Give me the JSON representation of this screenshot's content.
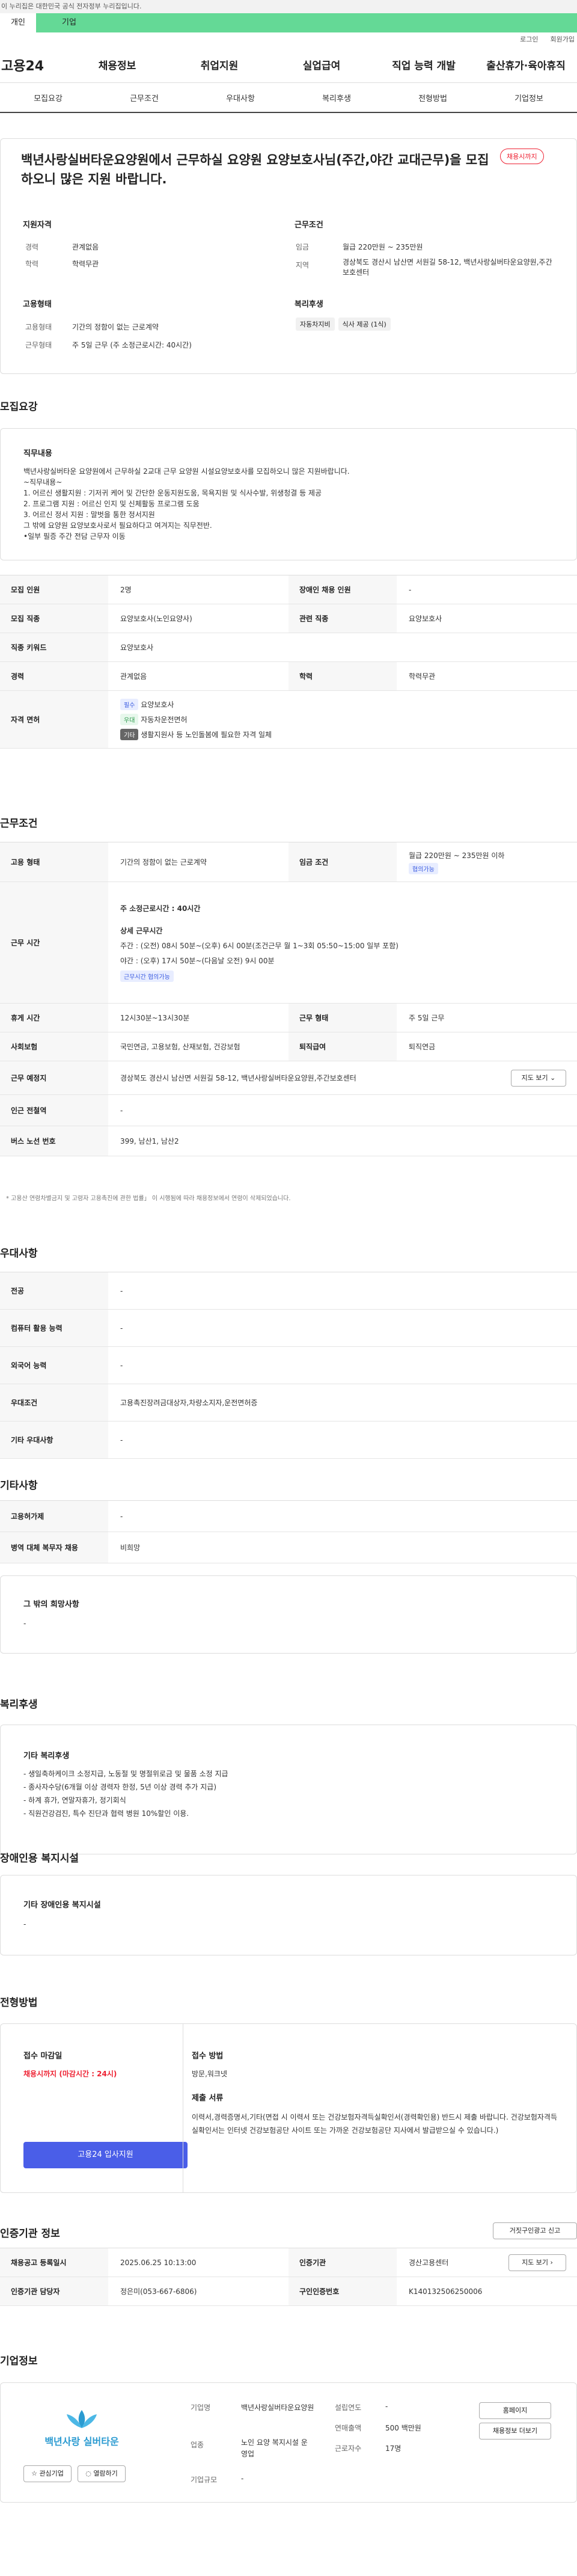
{
  "gov_banner": "이 누리집은 대한민국 공식 전자정부 누리집입니다.",
  "top_tabs": [
    "개인",
    "기업"
  ],
  "util": [
    "로그인",
    "회원가입"
  ],
  "logo": "고용24",
  "gnb": [
    "채용정보",
    "취업지원",
    "실업급여",
    "직업 능력 개발",
    "출산휴가·육아휴직"
  ],
  "subtabs": [
    "모집요강",
    "근무조건",
    "우대사항",
    "복리후생",
    "전형방법",
    "기업정보"
  ],
  "title": "백년사랑실버타운요양원에서 근무하실 요양원 요양보호사님(주간,야간 교대근무)을 모집하오니 많은 지원 바랍니다.",
  "status_badge": "채용시까지",
  "summary": {
    "qual_title": "지원자격",
    "career_k": "경력",
    "career_v": "관계없음",
    "edu_k": "학력",
    "edu_v": "학력무관",
    "cond_title": "근무조건",
    "wage_k": "임금",
    "wage_v": "월급 220만원 ~ 235만원",
    "area_k": "지역",
    "area_v": "경상북도 경산시 남산면 서원길 58-12, 백년사랑실버타운요양원,주간보호센터",
    "emp_title": "고용형태",
    "emp_k": "고용형태",
    "emp_v": "기간의 정함이 없는 근로계약",
    "work_k": "근무형태",
    "work_v": "주 5일 근무 (주 소정근로시간: 40시간)",
    "welfare_title": "복리후생",
    "welfare_chips": [
      "자동차지비",
      "식사 제공 (1식)"
    ]
  },
  "recruit": {
    "section": "모집요강",
    "duty_title": "직무내용",
    "duty_text": "백년사랑실버타운 요양원에서 근무하실 2교대 근무 요양원 시설요양보호사를 모집하오니 많은 지원바랍니다.\n~직무내용~\n1. 어르신 생활지원 : 기저귀 케어 및 간단한 운동지원도움, 목욕지원 및 식사수발, 위생청결 등 제공\n2. 프로그램 지원 : 어르신 인지 및 신체활동 프로그램 도움\n3. 어르신 정서 지원 : 말벗을 통한 정서지원\n그 밖에 요양원 요양보호사로서 필요하다고 여겨지는 직무전반.\n•일부 필증 주간 전담 근무자 이동",
    "rows": [
      {
        "k": "모집 인원",
        "v": "2명",
        "k2": "장애인 채용 인원",
        "v2": "-"
      },
      {
        "k": "모집 직종",
        "v": "요양보호사(노인요양사)",
        "k2": "관련 직종",
        "v2": "요양보호사"
      },
      {
        "k": "직종 키워드",
        "v": "요양보호사"
      },
      {
        "k": "경력",
        "v": "관계없음",
        "k2": "학력",
        "v2": "학력무관"
      }
    ],
    "license_k": "자격 면허",
    "licenses": [
      {
        "tag": "필수",
        "name": "요양보호사"
      },
      {
        "tag": "우대",
        "name": "자동차운전면허"
      },
      {
        "tag": "기타",
        "name": "생활지원사 등 노인돌봄에 필요한 자격 일체"
      }
    ]
  },
  "conditions": {
    "section": "근무조건",
    "emp_k": "고용 형태",
    "emp_v": "기간의 정함이 없는 근로계약",
    "wage_k": "임금 조건",
    "wage_v": "월급 220만원 ~ 235만원 이하",
    "wage_tag": "협의가능",
    "time_k": "근무 시간",
    "time_total": "주 소정근로시간 : 40시간",
    "time_detail_title": "상세 근무시간",
    "time_day": "주간 : (오전) 08시 50분~(오후) 6시 00분(조건근무 월 1~3회 05:50~15:00 일부 포함)",
    "time_night": "야간 : (오후) 17시 50분~(다음날 오전) 9시 00분",
    "time_tag": "근무시간 협의가능",
    "rest_k": "휴게 시간",
    "rest_v": "12시30분~13시30분",
    "form_k": "근무 형태",
    "form_v": "주 5일 근무",
    "ins_k": "사회보험",
    "ins_v": "국민연금, 고용보험, 산재보험, 건강보험",
    "retire_k": "퇴직급여",
    "retire_v": "퇴직연금",
    "place_k": "근무 예정지",
    "place_v": "경상북도 경산시 남산면 서원길 58-12, 백년사랑실버타운요양원,주간보호센터",
    "map_btn": "지도 보기 ⌄",
    "near_k": "인근 전철역",
    "near_v": "-",
    "bus_k": "버스 노선 번호",
    "bus_v": "399, 남산1, 남산2",
    "note": "* 고용산 연령차별금지 및 고령자 고용촉진에 관한 법률」 이 시행됨에 따라 채용정보에서 연령이 삭제되었습니다."
  },
  "pref": {
    "section": "우대사항",
    "rows": [
      {
        "k": "전공",
        "v": "-"
      },
      {
        "k": "컴퓨터 활용 능력",
        "v": "-"
      },
      {
        "k": "외국어 능력",
        "v": "-"
      },
      {
        "k": "우대조건",
        "v": "고용촉진장려금대상자,차량소지자,운전면허증"
      },
      {
        "k": "기타 우대사항",
        "v": "-"
      }
    ]
  },
  "etc": {
    "section": "기타사항",
    "rows": [
      {
        "k": "고용허가제",
        "v": "-"
      },
      {
        "k": "병역 대체 복무자 채용",
        "v": "비희망"
      }
    ],
    "other_title": "그 밖의 희망사항",
    "other_v": "-"
  },
  "welfare": {
    "section": "복리후생",
    "title": "기타 복리후생",
    "text": "- 생일축하케이크 소정지급,  노동절 및 명절위로금 및 물품 소정 지급\n- 종사자수당(6개월 이상 경력자 한정, 5년 이상 경력 추가 지급)\n- 하계 휴가, 연말자휴가, 정기회식\n- 직원건강검진, 특수 진단과 협력 병원 10%할인 이용."
  },
  "disabled": {
    "section": "장애인용 복지시설",
    "title": "기타 장애인용 복지시설",
    "v": "-"
  },
  "selection": {
    "section": "전형방법",
    "deadline_title": "접수 마감일",
    "deadline_v": "채용시까지 (마감시간 : 24시)",
    "apply_btn": "고용24 입사지원",
    "method_title": "접수 방법",
    "method_v": "방문,워크넷",
    "docs_title": "제출 서류",
    "docs_v": "이력서,경력증명서,기타(면접 시 이력서 또는 건강보험자격득실확인서(경력확인용) 반드시 제출 바랍니다. 건강보험자격득실확인서는 인터넷 건강보험공단 사이트 또는 가까운 건강보험공단 지사에서 발급받으실 수 있습니다.)"
  },
  "auth": {
    "section": "인증기관 정보",
    "report_btn": "거짓구인광고 신고",
    "reg_k": "채용공고 등록일시",
    "reg_v": "2025.06.25 10:13:00",
    "org_k": "인증기관",
    "org_v": "경산고용센터",
    "map_btn": "지도 보기 ›",
    "mgr_k": "인증기관 담당자",
    "mgr_v": "정은미(053-667-6806)",
    "id_k": "구인인증번호",
    "id_v": "K140132506250006"
  },
  "company": {
    "section": "기업정보",
    "logo_text": "백년사랑 실버타운",
    "fav_btn": "관심기업",
    "follow_btn": "열람하기",
    "name_k": "기업명",
    "name_v": "백년사랑실버타운요양원",
    "est_k": "설립연도",
    "est_v": "-",
    "ind_k": "업종",
    "ind_v": "노인 요양 복지시설 운영업",
    "sales_k": "연매출액",
    "sales_v": "500 백만원",
    "emp_k": "근로자수",
    "emp_v": "17명",
    "size_k": "기업규모",
    "size_v": "-",
    "home_btn": "홈페이지",
    "jobs_btn": "채용정보 더보기"
  }
}
